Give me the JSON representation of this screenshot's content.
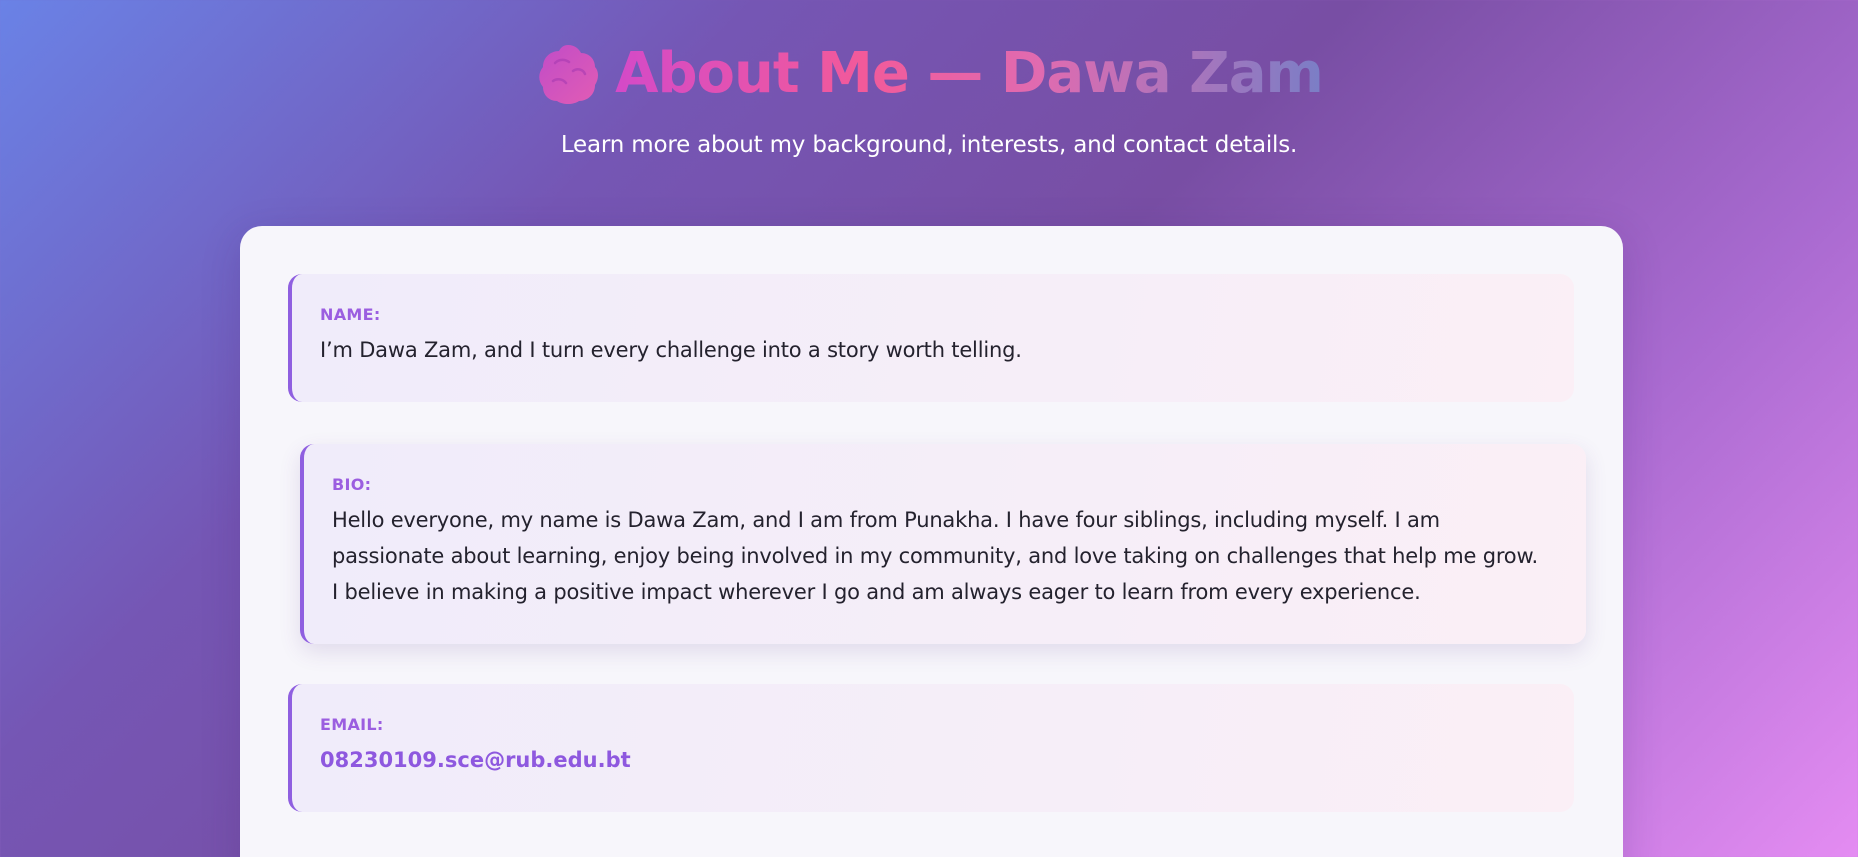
{
  "header": {
    "icon": "blob-icon",
    "title": "About Me — Dawa Zam",
    "subtitle": "Learn more about my background, interests, and contact details."
  },
  "sections": {
    "name": {
      "label": "NAME:",
      "value": "I’m Dawa Zam, and I turn every challenge into a story worth telling."
    },
    "bio": {
      "label": "BIO:",
      "value": "Hello everyone, my name is Dawa Zam, and I am from Punakha. I have four siblings, including myself. I am passionate about learning, enjoy being involved in my community, and love taking on challenges that help me grow. I believe in making a positive impact wherever I go and am always eager to learn from every experience."
    },
    "email": {
      "label": "EMAIL:",
      "value": "08230109.sce@rub.edu.bt"
    }
  },
  "colors": {
    "accent": "#8f5fe0",
    "title_gradient_start": "#d44ac8",
    "title_gradient_end": "#7a7ec6",
    "background_start": "#6a82e6",
    "background_end": "#e48cf2"
  }
}
